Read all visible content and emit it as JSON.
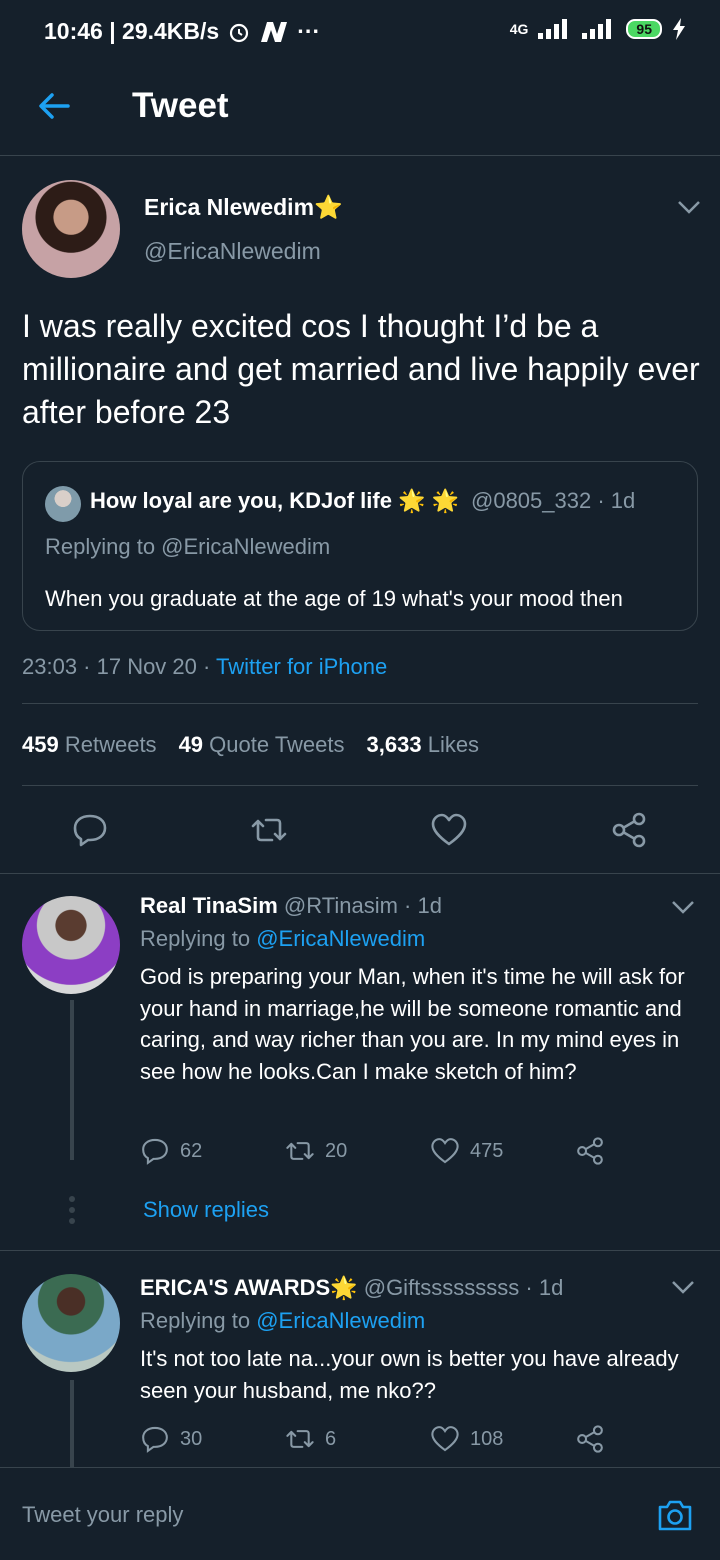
{
  "status_bar": {
    "time_speed": "10:46 | 29.4KB/s",
    "network": "4G",
    "battery": "95"
  },
  "header": {
    "title": "Tweet"
  },
  "tweet": {
    "author_name": "Erica Nlewedim",
    "author_badge": "⭐",
    "author_handle": "@EricaNlewedim",
    "text": "I was really excited cos I thought I’d be a millionaire and get married and live happily ever after before 23",
    "quote": {
      "name": "How loyal are you, KDJof life 🌟 🌟",
      "handle_time": "@0805_332 · 1d",
      "replying": "Replying to @EricaNlewedim",
      "text": "When you graduate at the age of 19 what's your mood then"
    },
    "time": "23:03 · 17 Nov 20 · ",
    "client": "Twitter for iPhone",
    "retweets": "459",
    "retweets_label": "Retweets",
    "quotes": "49",
    "quotes_label": "Quote Tweets",
    "likes": "3,633",
    "likes_label": "Likes"
  },
  "replies": [
    {
      "name": "Real TinaSim",
      "handle_time": "@RTinasim · 1d",
      "replying_prefix": "Replying to ",
      "replying_to": "@EricaNlewedim",
      "text": "God is preparing your Man, when it's time he will ask for your hand in marriage,he will be someone romantic and caring, and way richer than you are. In my mind eyes in see how he looks.Can I make sketch of him?",
      "comments": "62",
      "retweets": "20",
      "likes": "475",
      "show_replies": "Show replies"
    },
    {
      "name": "ERICA'S AWARDS🌟",
      "handle_time": "@Giftsssssssss · 1d",
      "replying_prefix": "Replying to ",
      "replying_to": "@EricaNlewedim",
      "text": "It's not too late na...your own is better you have already seen your husband, me nko??",
      "comments": "30",
      "retweets": "6",
      "likes": "108"
    }
  ],
  "reply_bar": {
    "placeholder": "Tweet your reply"
  },
  "colors": {
    "background": "#15202b",
    "accent": "#1da1f2",
    "muted": "#8899a6",
    "border": "#38444d"
  },
  "icons": [
    "back-arrow-icon",
    "chevron-down-icon",
    "comment-icon",
    "retweet-icon",
    "heart-icon",
    "share-icon",
    "camera-icon"
  ]
}
